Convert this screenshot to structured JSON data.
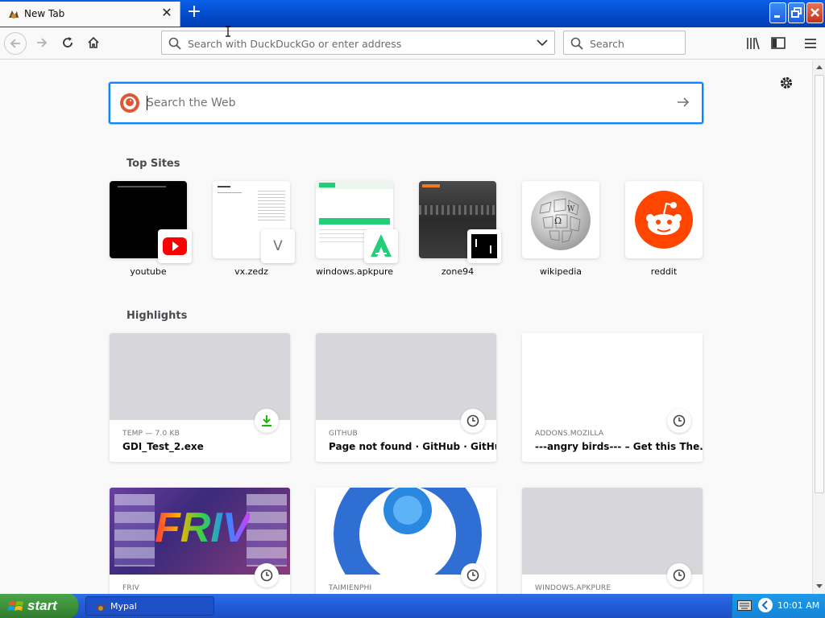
{
  "tab": {
    "title": "New Tab",
    "close": "✕"
  },
  "newtab": "+",
  "navbar": {
    "url_placeholder": "Search with DuckDuckGo or enter address",
    "search_placeholder": "Search"
  },
  "content": {
    "websearch_placeholder": "Search the Web",
    "top_sites_title": "Top Sites",
    "top_sites": [
      {
        "label": "youtube"
      },
      {
        "label": "vx.zedz",
        "badge_letter": "V"
      },
      {
        "label": "windows.apkpure"
      },
      {
        "label": "zone94"
      },
      {
        "label": "wikipedia"
      },
      {
        "label": "reddit"
      }
    ],
    "highlights_title": "Highlights",
    "highlights": [
      {
        "context": "TEMP — 7.0 KB",
        "title": "GDI_Test_2.exe",
        "icon": "download-icon"
      },
      {
        "context": "GITHUB",
        "title": "Page not found · GitHub · GitHub",
        "icon": "clock-icon"
      },
      {
        "context": "ADDONS.MOZILLA",
        "title": "---angry birds--- – Get this The...",
        "icon": "clock-icon"
      },
      {
        "context": "FRIV",
        "title": "",
        "icon": "clock-icon"
      },
      {
        "context": "TAIMIENPHI",
        "title": "",
        "icon": "clock-icon"
      },
      {
        "context": "WINDOWS.APKPURE",
        "title": "",
        "icon": "clock-icon"
      }
    ]
  },
  "taskbar": {
    "start_label": "start",
    "task_label": "Mypal",
    "clock": "10:01 AM"
  },
  "colors": {
    "accent": "#0a84ff",
    "reddit": "#ff4500",
    "youtube": "#ff0000",
    "ddg": "#de5833"
  }
}
